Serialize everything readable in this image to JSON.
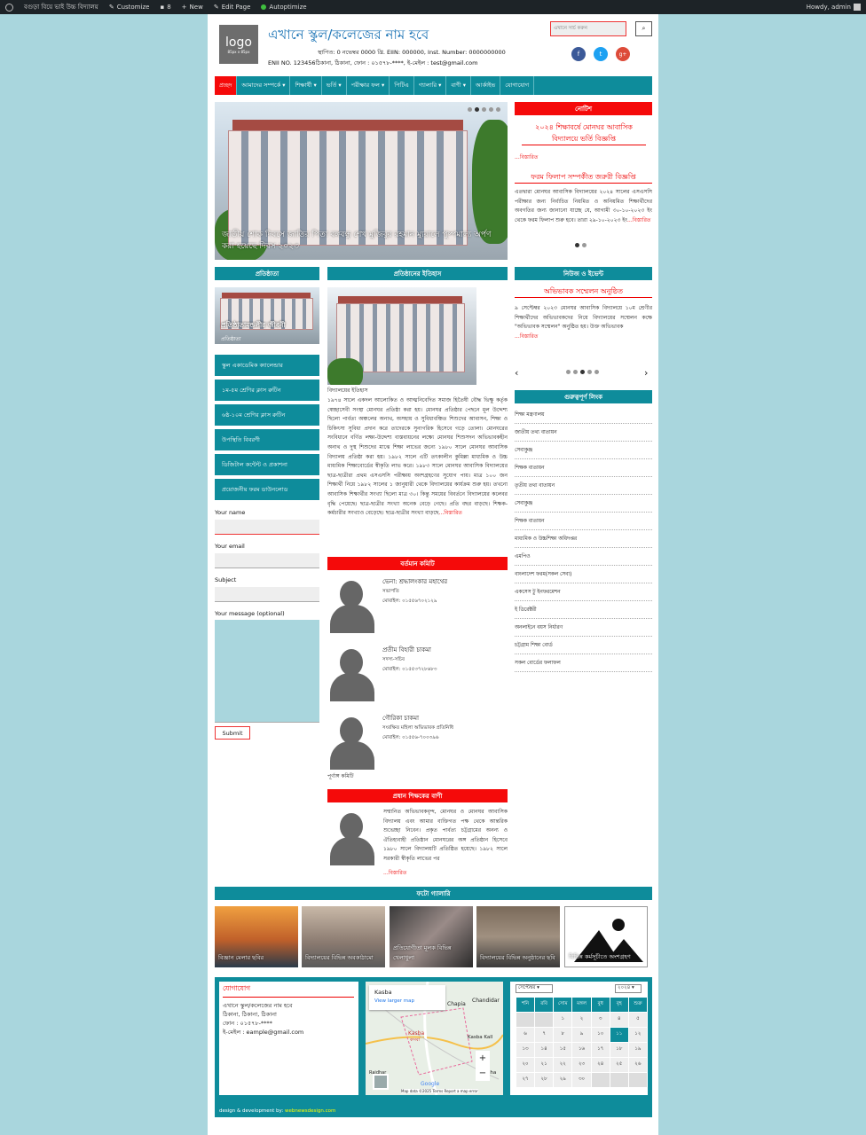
{
  "adminbar": {
    "site": "বগুড়া বিয়ে ভাই উচ্চ বিদ্যালয়",
    "customize": "Customize",
    "comments": "8",
    "new": "New",
    "edit": "Edit Page",
    "autoptimize": "Autoptimize",
    "howdy": "Howdy, admin"
  },
  "header": {
    "logo": "logo",
    "logo_size": "85px x 85px",
    "title": "এখানে স্কুল/কলেজের নাম হবে",
    "line1": "স্থাপিত: 0 নভেম্বর 0000 খ্রি. EIIN: 000000, Inst. Number: 0000000000",
    "line2": "ENII NO. 123456ঠিকানা, ঠিকানা, ফোন : ০১৫৭৮-****, ই-মেইল : test@gmail.com",
    "search_placeholder": "এখানে সার্চ করুন",
    "social": [
      "f",
      "t",
      "g+"
    ]
  },
  "nav": [
    "প্রচ্ছদ",
    "আমাদের সম্পর্কে ▾",
    "শিক্ষার্থী ▾",
    "ভর্তি ▾",
    "পরীক্ষার ফল ▾",
    "পিটিএ",
    "গ্যালারি ▾",
    "বাণী ▾",
    "আর্কাইভ",
    "যোগাযোগ"
  ],
  "slider": {
    "caption": "জাতীয় শোক দিবসে জাতির পিতা বঙ্গবন্ধু শেখ মুজিবুর রহমান ম্যুরালে পুষ্পমাল্য অর্পণ করা হয়েছে দিবস ২০২৩"
  },
  "notice": {
    "title": "নোটিশ",
    "h1": "২০২৪ শিক্ষাবর্ষে মোনঘর আবাসিক বিদ্যালয়ে ভর্তি বিজ্ঞপ্তি",
    "more1": "...বিস্তারিত",
    "h2": "ফরম ফিলাপ সম্পর্কীত জরুরী বিজ্ঞপ্তি",
    "body2": "এতদ্বারা মোনঘর আবাসিক বিদ্যালয়ের ২০২৪ সালের এসএসসি পরীক্ষার জন্য নির্বাচিত নিয়মিত ও অনিয়মিত শিক্ষার্থীদের অবগতির জন্য জানানো যাচ্ছে যে, আগামী ৩০-১০-২০২৩ ইং থেকে ফরম ফিলাপ শুরু হবে। তারা ২৯-১০-২০২৩ ইং",
    "more2": "...বিস্তারিত"
  },
  "founder": {
    "title": "প্রতিষ্ঠাতা",
    "caption": "প্রতিষ্ঠাতামন্ডলীর জীবনী",
    "sub": "প্রতিষ্ঠাতা"
  },
  "history": {
    "title": "প্রতিষ্ঠানের ইতিহাস",
    "h": "বিদ্যালয়ের ইতিহাস",
    "body": "১৯৭৪ সালে একদল আলোকিত ও আত্মনিবেদিত সমাজ হিতৈষী বৌদ্ধ ভিক্ষু কর্তৃক স্বেচ্ছাসেবী সংস্থা মোনঘর প্রতিষ্ঠা করা হয়। মোনঘর প্রতিষ্ঠার পেছনে মূল উদ্দেশ্য ছিলো পার্বত্য অঞ্চলের অনাথ, অসহায় ও সুবিধাবঞ্চিত শিশুদের আবাসন, শিক্ষা ও চিকিৎসা সুবিধা প্রদান করে তাদেরকে সুনাগরিক হিসেবে গড়ে তোলা। মোনঘরের সংবিধানে বর্ণিত লক্ষ্য-উদ্দেশ্য বাস্তবায়নের লক্ষ্যে মোনঘর শিশুসদন অভিভাবকহীন অনাথ ও দুস্থ শিশুদের মাঝে শিক্ষা লাভের জন্যে ১৯৮০ সালে মোনঘর আবাসিক বিদ্যালয় প্রতিষ্ঠা করা হয়। ১৯৮২ সালে এটি তৎকালীন কুমিল্লা মাধ্যমিক ও উচ্চ মাধ্যমিক শিক্ষাবোর্ডের স্বীকৃতি লাভ করে। ১৯৮৩ সালে মোনঘর আবাসিক বিদ্যালয়ের ছাত্র-ছাত্রীরা প্রথম এসএসসি পরীক্ষায় অংশগ্রহণের সুযোগ পায়। মাত্র ১০০ জন শিক্ষার্থী নিয়ে ১৯৮২ সালের ১ জানুয়ারী থেকে বিদ্যালয়ের কার্যক্রম শুরু হয়। তখনো আবাসিক শিক্ষার্থীর সংখ্যা ছিলো মাত্র ৩০। কিন্তু সময়ের বিবর্তনে বিদ্যালয়ের কলেবর বৃদ্ধি পেয়েছে। ছাত্র-ছাত্রীর সংখ্যা অনেক বেড়ে গেছে। প্রতি বছর বাড়ছে। শিক্ষক-কর্মচারীর সংখ্যাও বেড়েছে। ছাত্র-ছাত্রীর সংখ্যা বাড়ছে",
    "more": "...বিস্তারিত"
  },
  "news": {
    "title": "নিউজ ও ইভেন্ট",
    "h": "অভিভাবক সম্মেলন অনুষ্ঠিত",
    "body": "৯ সেপ্টেম্বর ২০২৩ মোনঘর আবাসিক বিদ্যালয়ে ১০ম শ্রেণীর শিক্ষার্থীদের অভিভাবকদের নিয়ে বিদ্যালয়ের সম্মেলন কক্ষে \"অভিভাবক সম্মেলন\" অনুষ্ঠিত হয়। উক্ত অভিভাবক",
    "more": "...বিস্তারিত"
  },
  "quicklinks": {
    "title": "গুরুত্বপূর্ণ লিংক",
    "items": [
      "শিক্ষা মন্ত্রণালয়",
      "জাতীয় তথ্য বাতায়ন",
      "সেবাকুঞ্জ",
      "শিক্ষক বাতায়ন",
      "তৃতীয় তথ্য বাতায়ন",
      "সেবাকুঞ্জ",
      "শিক্ষক বাতায়ন",
      "মাধ্যমিক ও উচ্চশিক্ষা অধিদপ্তর",
      "এমপিও",
      "বাংলাদেশ ফরম(সকল সেবা)",
      "একসেস টু ইনফরমেশন",
      "ই ডিরেক্টরী",
      "অনলাইনে বয়স নির্ধারণ",
      "চট্টগ্রাম শিক্ষা বোর্ড",
      "সকল বোর্ডের ফলাফল"
    ]
  },
  "sidemenu": [
    "স্কুল একাডেমিক ক্যালেন্ডার",
    "১ম-৫ম শ্রেণির ক্লাস রুটিন",
    "৬ষ্ঠ-১০ম শ্রেণির ক্লাস রুটিন",
    "উপস্থিতি বিবরণী",
    "ডিজিটাল কন্টেন্ট ও প্রকাশনা",
    "প্রয়োজনীয় ফরম ডাউনলোড"
  ],
  "form": {
    "name": "Your name",
    "email": "Your email",
    "subject": "Subject",
    "message": "Your message (optional)",
    "submit": "Submit"
  },
  "committee": {
    "title": "বর্তমান কমিটি",
    "members": [
      {
        "name": "ভেনা: শ্রদ্ধালংকার মহাথের",
        "role": "সভাপতি",
        "phone": "মোবাইল: ০১৫৫৬৭০২১২৯"
      },
      {
        "name": "প্রতীম বিহারী চাকমা",
        "role": "সদস্য-সচিব",
        "phone": "মোবাইল: ০১৫৫৩৭২৮৬৮৩"
      },
      {
        "name": "গৌরিকা চাকমা",
        "role": "সংরক্ষিত মহিলা অভিভাবক প্রতিনিধি",
        "phone": "মোবাইল: ০১৫৫৬-৭০০৩৯৬"
      }
    ],
    "full": "পূর্ণাঙ্গ কমিটি"
  },
  "headmaster": {
    "title": "প্রধান শিক্ষকের বাণী",
    "body": "সম্মানিত অভিভাবকবৃন্দ, মোনঘর ও মোনঘর আবাসিক বিদ্যালয় এবং আমার ব্যক্তিগত পক্ষ থেকে আন্তরিক শুভেচ্ছা নিবেন। প্রকৃত পার্বত্য চট্টগ্রামের অনন্য ও ঐতিহ্যবাহী প্রতিষ্ঠান মোনঘরের অঙ্গ প্রতিষ্ঠান হিসেবে ১৯৮০ সালে বিদ্যালয়টি প্রতিষ্ঠিত হয়েছে। ১৯৮২ সালে সরকারী স্বীকৃতি লাভের পর",
    "more": "...বিস্তারিত"
  },
  "gallery": {
    "title": "ফটো গ্যালারি",
    "items": [
      "বিজ্ঞান মেলার ছবির",
      "বিদ্যালয়ের বিভিন্ন অবকাঠামো",
      "প্রতিযোগীতা মূলক বিভিন্ন খেলাধুলা",
      "বিদ্যালয়ের বিভিন্ন অনুষ্ঠানের ছবি",
      "বিভিন্ন কর্মসূচীতে অংশগ্রহণ"
    ]
  },
  "contact": {
    "title": "যোগাযোগ",
    "lines": [
      "এখানে স্কুল/কলেজের নাম হবে",
      "ঠিকানা, ঠিকানা, ঠিকানা",
      "ফোন : ০১৫৭৮-****",
      "ই-মেইল : eample@gmail.com"
    ]
  },
  "map": {
    "place": "Kasba",
    "view": "View larger map",
    "labels": [
      "Chapia",
      "Chandidar",
      "Kasba",
      "কসবা",
      "Kasba Kall",
      "Radha",
      "Rajdhar",
      "Google"
    ],
    "footer": "Map data ©2025  Terms  Report a map error"
  },
  "calendar": {
    "month": "সেপ্টেম্বর",
    "year": "২০২৪",
    "days": [
      "শনি",
      "রবি",
      "সোম",
      "মঙ্গল",
      "বুধ",
      "বৃহ",
      "শুক্র"
    ],
    "rows": [
      [
        "",
        "",
        "১",
        "২",
        "৩",
        "৪",
        "৫"
      ],
      [
        "৬",
        "৭",
        "৮",
        "৯",
        "১০",
        "১১",
        "১২"
      ],
      [
        "১৩",
        "১৪",
        "১৫",
        "১৬",
        "১৭",
        "১৮",
        "১৯"
      ],
      [
        "২০",
        "২১",
        "২২",
        "২৩",
        "২৪",
        "২৫",
        "২৬"
      ],
      [
        "২৭",
        "২৮",
        "২৯",
        "৩০",
        "",
        "",
        ""
      ]
    ],
    "today": "১১"
  },
  "credit": {
    "text": "design & development by:",
    "link": "webnewsdesign.com"
  },
  "colors": {
    "teal": "#0e8c9b",
    "red": "#f50a0a",
    "bg": "#a9d6dd"
  }
}
